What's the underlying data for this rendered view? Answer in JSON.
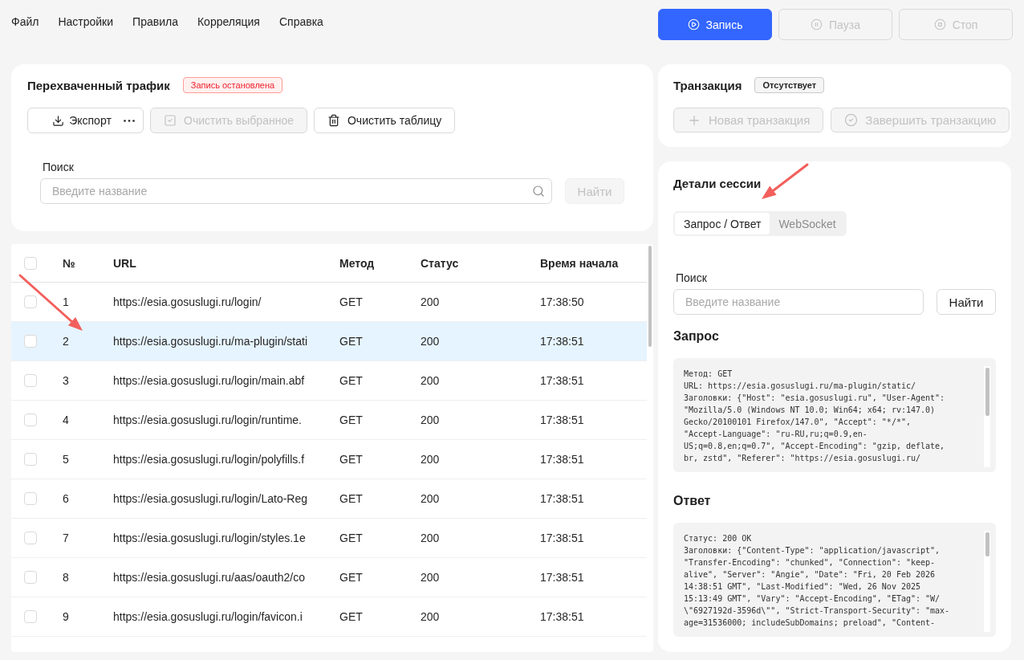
{
  "menu": [
    "Файл",
    "Настройки",
    "Правила",
    "Корреляция",
    "Справка"
  ],
  "toolbar": [
    {
      "label": "Запись",
      "kind": "record",
      "disabled": false
    },
    {
      "label": "Пауза",
      "kind": "pause",
      "disabled": true
    },
    {
      "label": "Стоп",
      "kind": "stop",
      "disabled": true
    }
  ],
  "traffic": {
    "title": "Перехваченный трафик",
    "badge": {
      "label": "Запись остановлена",
      "kind": "error"
    },
    "actions": [
      {
        "label": "Экспорт",
        "kind": "export",
        "disabled": false
      },
      {
        "label": "Очистить выбранное",
        "kind": "clear_selected",
        "disabled": true
      },
      {
        "label": "Очистить таблицу",
        "kind": "clear_table",
        "disabled": false
      }
    ],
    "search": {
      "label": "Поиск",
      "placeholder": "Введите название",
      "search_icon": true,
      "button": {
        "label": "Найти",
        "disabled": true
      }
    }
  },
  "table": {
    "select_all": {
      "checked": false
    },
    "columns": [
      "№",
      "URL",
      "Метод",
      "Статус",
      "Время начала"
    ],
    "rows": [
      {
        "number": "1",
        "url": "https://esia.gosuslugi.ru/login/",
        "method": "GET",
        "status": "200",
        "start_time": "17:38:50",
        "checked": false,
        "selected": false
      },
      {
        "number": "2",
        "url": "https://esia.gosuslugi.ru/ma-plugin/stati",
        "method": "GET",
        "status": "200",
        "start_time": "17:38:51",
        "checked": false,
        "selected": true
      },
      {
        "number": "3",
        "url": "https://esia.gosuslugi.ru/login/main.abf",
        "method": "GET",
        "status": "200",
        "start_time": "17:38:51",
        "checked": false,
        "selected": false
      },
      {
        "number": "4",
        "url": "https://esia.gosuslugi.ru/login/runtime.",
        "method": "GET",
        "status": "200",
        "start_time": "17:38:51",
        "checked": false,
        "selected": false
      },
      {
        "number": "5",
        "url": "https://esia.gosuslugi.ru/login/polyfills.f",
        "method": "GET",
        "status": "200",
        "start_time": "17:38:51",
        "checked": false,
        "selected": false
      },
      {
        "number": "6",
        "url": "https://esia.gosuslugi.ru/login/Lato-Reg",
        "method": "GET",
        "status": "200",
        "start_time": "17:38:51",
        "checked": false,
        "selected": false
      },
      {
        "number": "7",
        "url": "https://esia.gosuslugi.ru/login/styles.1e",
        "method": "GET",
        "status": "200",
        "start_time": "17:38:51",
        "checked": false,
        "selected": false
      },
      {
        "number": "8",
        "url": "https://esia.gosuslugi.ru/aas/oauth2/co",
        "method": "GET",
        "status": "200",
        "start_time": "17:38:51",
        "checked": false,
        "selected": false
      },
      {
        "number": "9",
        "url": "https://esia.gosuslugi.ru/login/favicon.i",
        "method": "GET",
        "status": "200",
        "start_time": "17:38:51",
        "checked": false,
        "selected": false
      }
    ]
  },
  "transaction": {
    "title": "Транзакция",
    "badge": {
      "label": "Отсутствует",
      "kind": "neutral"
    },
    "actions": [
      {
        "label": "Новая транзакция",
        "kind": "new",
        "disabled": true
      },
      {
        "label": "Завершить транзакцию",
        "kind": "finish",
        "disabled": true
      }
    ]
  },
  "session": {
    "title": "Детали сессии",
    "tabs": [
      {
        "label": "Запрос / Ответ",
        "selected": true
      },
      {
        "label": "WebSocket",
        "selected": false
      }
    ],
    "search": {
      "label": "Поиск",
      "placeholder": "Введите название",
      "button": {
        "label": "Найти",
        "disabled": false
      }
    },
    "request": {
      "title": "Запрос",
      "lines": [
        "Метод: GET",
        "URL: https://esia.gosuslugi.ru/ma-plugin/static/",
        "Заголовки: {\"Host\": \"esia.gosuslugi.ru\", \"User-Agent\":",
        "\"Mozilla/5.0 (Windows NT 10.0; Win64; x64; rv:147.0)",
        "Gecko/20100101 Firefox/147.0\", \"Accept\": \"*/*\",",
        "\"Accept-Language\": \"ru-RU,ru;q=0.9,en-",
        "US;q=0.8,en;q=0.7\", \"Accept-Encoding\": \"gzip, deflate,",
        "br, zstd\", \"Referer\": \"https://esia.gosuslugi.ru/"
      ]
    },
    "response": {
      "title": "Ответ",
      "lines": [
        "Статус: 200 OK",
        "Заголовки: {\"Content-Type\": \"application/javascript\",",
        "\"Transfer-Encoding\": \"chunked\", \"Connection\": \"keep-",
        "alive\", \"Server\": \"Angie\", \"Date\": \"Fri, 20 Feb 2026",
        "14:38:51 GMT\", \"Last-Modified\": \"Wed, 26 Nov 2025",
        "15:13:49 GMT\", \"Vary\": \"Accept-Encoding\", \"ETag\": \"W/",
        "\\\"6927192d-3596d\\\"\", \"Strict-Transport-Security\": \"max-",
        "age=31536000; includeSubDomains; preload\", \"Content-"
      ]
    }
  }
}
